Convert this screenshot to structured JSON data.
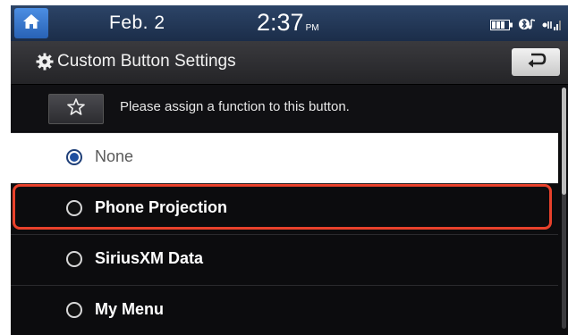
{
  "status": {
    "date": "Feb.  2",
    "time": "2:37",
    "ampm": "PM"
  },
  "header": {
    "title": "Custom Button Settings"
  },
  "instruction": {
    "text": "Please assign a function to this button."
  },
  "options": [
    {
      "label": "None",
      "selected": true
    },
    {
      "label": "Phone Projection",
      "selected": false
    },
    {
      "label": "SiriusXM Data",
      "selected": false
    },
    {
      "label": "My Menu",
      "selected": false
    }
  ],
  "colors": {
    "highlight": "#e8412b",
    "status_bar": "#24395a",
    "home_button": "#3a78cc"
  },
  "icons": [
    "home-icon",
    "battery-icon",
    "bluetooth-audio-icon",
    "signal-icon",
    "gear-icon",
    "back-arrow-icon",
    "star-icon"
  ]
}
